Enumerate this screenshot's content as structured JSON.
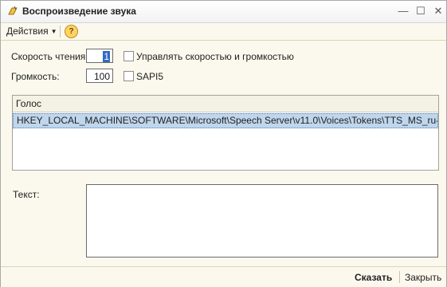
{
  "window": {
    "title": "Воспроизведение звука"
  },
  "toolbar": {
    "actions_label": "Действия",
    "help_label": "?"
  },
  "form": {
    "speed_label": "Скорость чтения:",
    "speed_value": "1",
    "manage_label": "Управлять скоростью и громкостью",
    "volume_label": "Громкость:",
    "volume_value": "100",
    "sapi_label": "SAPI5",
    "manage_checked": false,
    "sapi_checked": false
  },
  "grid": {
    "header": "Голос",
    "rows": [
      "HKEY_LOCAL_MACHINE\\SOFTWARE\\Microsoft\\Speech Server\\v11.0\\Voices\\Tokens\\TTS_MS_ru-RU_..."
    ]
  },
  "text": {
    "label": "Текст:",
    "value": ""
  },
  "footer": {
    "say_label": "Сказать",
    "close_label": "Закрыть"
  },
  "colors": {
    "selection": "#bfd6ec",
    "background": "#fbf9ee"
  }
}
